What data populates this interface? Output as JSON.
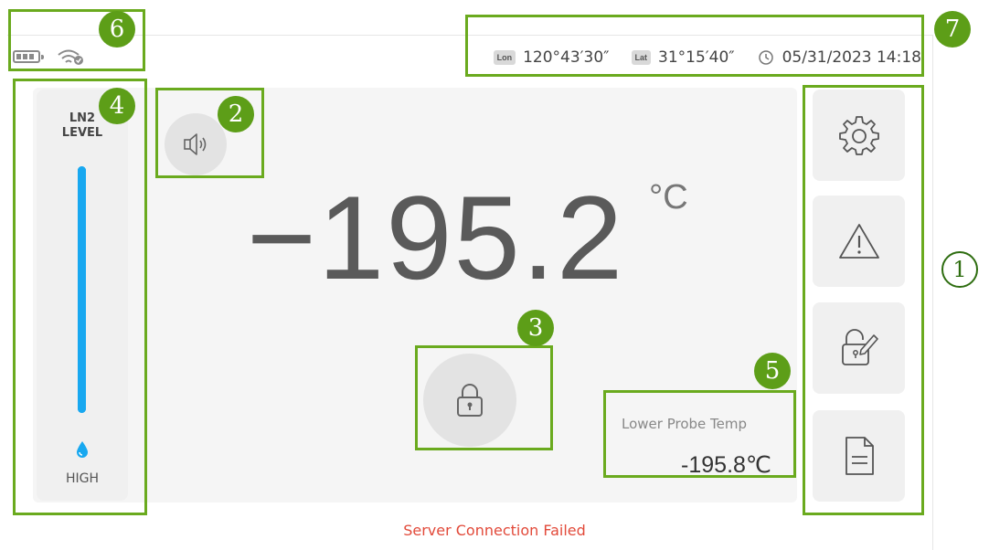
{
  "status": {
    "battery_icon": "battery-icon",
    "wifi_icon": "wifi-connected-icon"
  },
  "location": {
    "lon_tag": "Lon",
    "lon_value": "120°43′30″",
    "lat_tag": "Lat",
    "lat_value": "31°15′40″",
    "clock_icon": "clock-icon",
    "datetime": "05/31/2023 14:18"
  },
  "ln2": {
    "title_line1": "LN2",
    "title_line2": "LEVEL",
    "level_fraction": 1.0,
    "level_label": "HIGH"
  },
  "temperature": {
    "value": "−195.2",
    "unit": "°C"
  },
  "probe": {
    "label": "Lower Probe Temp",
    "value": "-195.8℃"
  },
  "side_menu": [
    {
      "icon": "gear-icon"
    },
    {
      "icon": "warning-icon"
    },
    {
      "icon": "lock-edit-icon"
    },
    {
      "icon": "document-icon"
    }
  ],
  "alert": {
    "message": "Server Connection Failed"
  },
  "annotations": {
    "badge1": "1",
    "badge2": "2",
    "badge3": "3",
    "badge4": "4",
    "badge5": "5",
    "badge6": "6",
    "badge7": "7"
  },
  "colors": {
    "accent_green": "#6aaa1e",
    "level_blue": "#18a8f0",
    "error_red": "#e24a3a"
  }
}
